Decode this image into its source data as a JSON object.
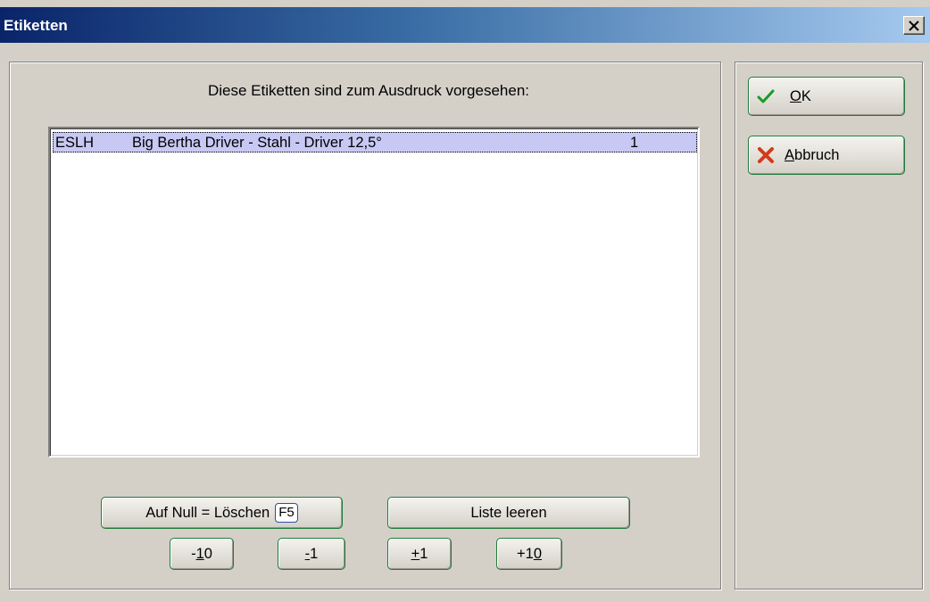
{
  "window": {
    "title": "Etiketten"
  },
  "caption": "Diese Etiketten sind zum Ausdruck vorgesehen:",
  "list": {
    "rows": [
      {
        "code": "ESLH",
        "description": "Big Bertha Driver - Stahl - Driver 12,5°",
        "quantity": "1"
      }
    ]
  },
  "buttons": {
    "ok": {
      "label_u": "O",
      "label_rest": "K",
      "icon": "checkmark-icon"
    },
    "cancel": {
      "label_u": "A",
      "label_rest": "bbruch",
      "icon": "cross-icon"
    },
    "set_zero": {
      "label": "Auf Null = Löschen",
      "shortcut": "F5"
    },
    "clear_list": {
      "label": "Liste leeren"
    },
    "minus10": {
      "pre": "-",
      "u": "1",
      "post": "0"
    },
    "minus1": {
      "pre": "",
      "u": "-",
      "post": "1"
    },
    "plus1": {
      "pre": "",
      "u": "+",
      "post": "1"
    },
    "plus10": {
      "pre": "+1",
      "u": "0",
      "post": ""
    }
  }
}
